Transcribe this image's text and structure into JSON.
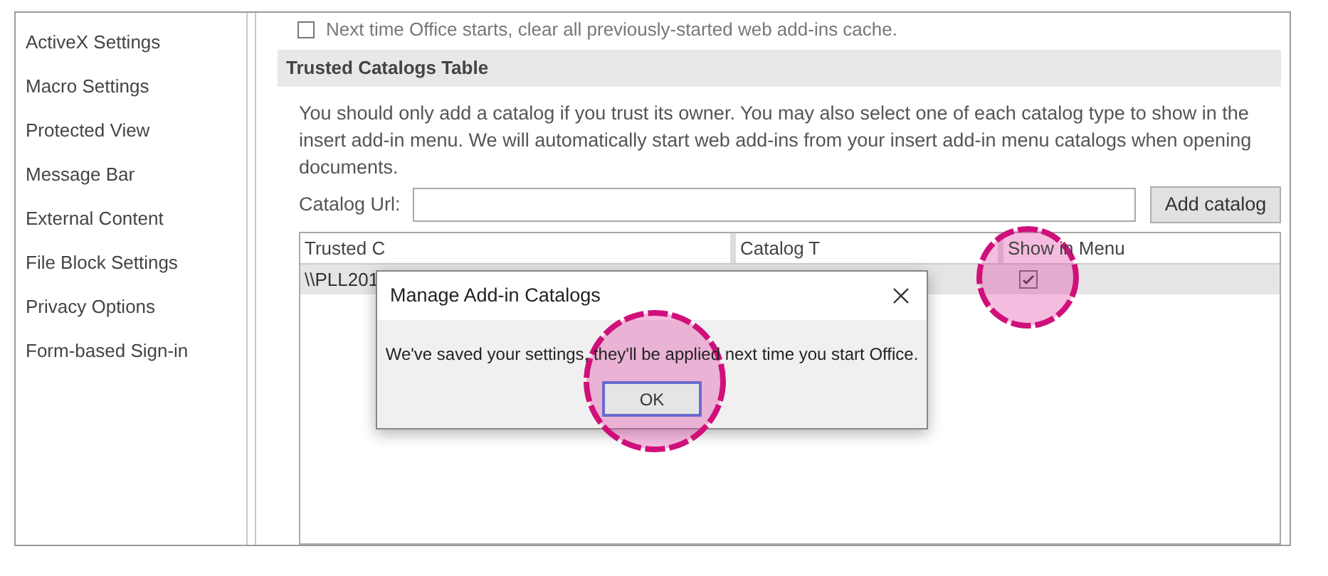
{
  "sidebar": {
    "items": [
      {
        "label": "ActiveX Settings"
      },
      {
        "label": "Macro Settings"
      },
      {
        "label": "Protected View"
      },
      {
        "label": "Message Bar"
      },
      {
        "label": "External Content"
      },
      {
        "label": "File Block Settings"
      },
      {
        "label": "Privacy Options"
      },
      {
        "label": "Form-based Sign-in"
      }
    ]
  },
  "cache_option": {
    "label": "Next time Office starts, clear all previously-started web add-ins cache.",
    "checked": false
  },
  "section": {
    "title": "Trusted Catalogs Table",
    "description": "You should only add a catalog if you trust its owner. You may also select one of each catalog type to show in the insert add-in menu. We will automatically start web add-ins from your insert add-in menu catalogs when opening documents."
  },
  "catalog_url": {
    "label": "Catalog Url:"
  },
  "add_button": "Add catalog",
  "table": {
    "columns": [
      "Trusted C",
      "Catalog T",
      "Show in Menu"
    ],
    "rows": [
      {
        "address": "\\\\PLL201",
        "selected": true,
        "show_in_menu": true
      }
    ]
  },
  "dialog": {
    "title": "Manage Add-in Catalogs",
    "message": "We've saved your settings, they'll be applied next time you start Office.",
    "button": "OK"
  }
}
